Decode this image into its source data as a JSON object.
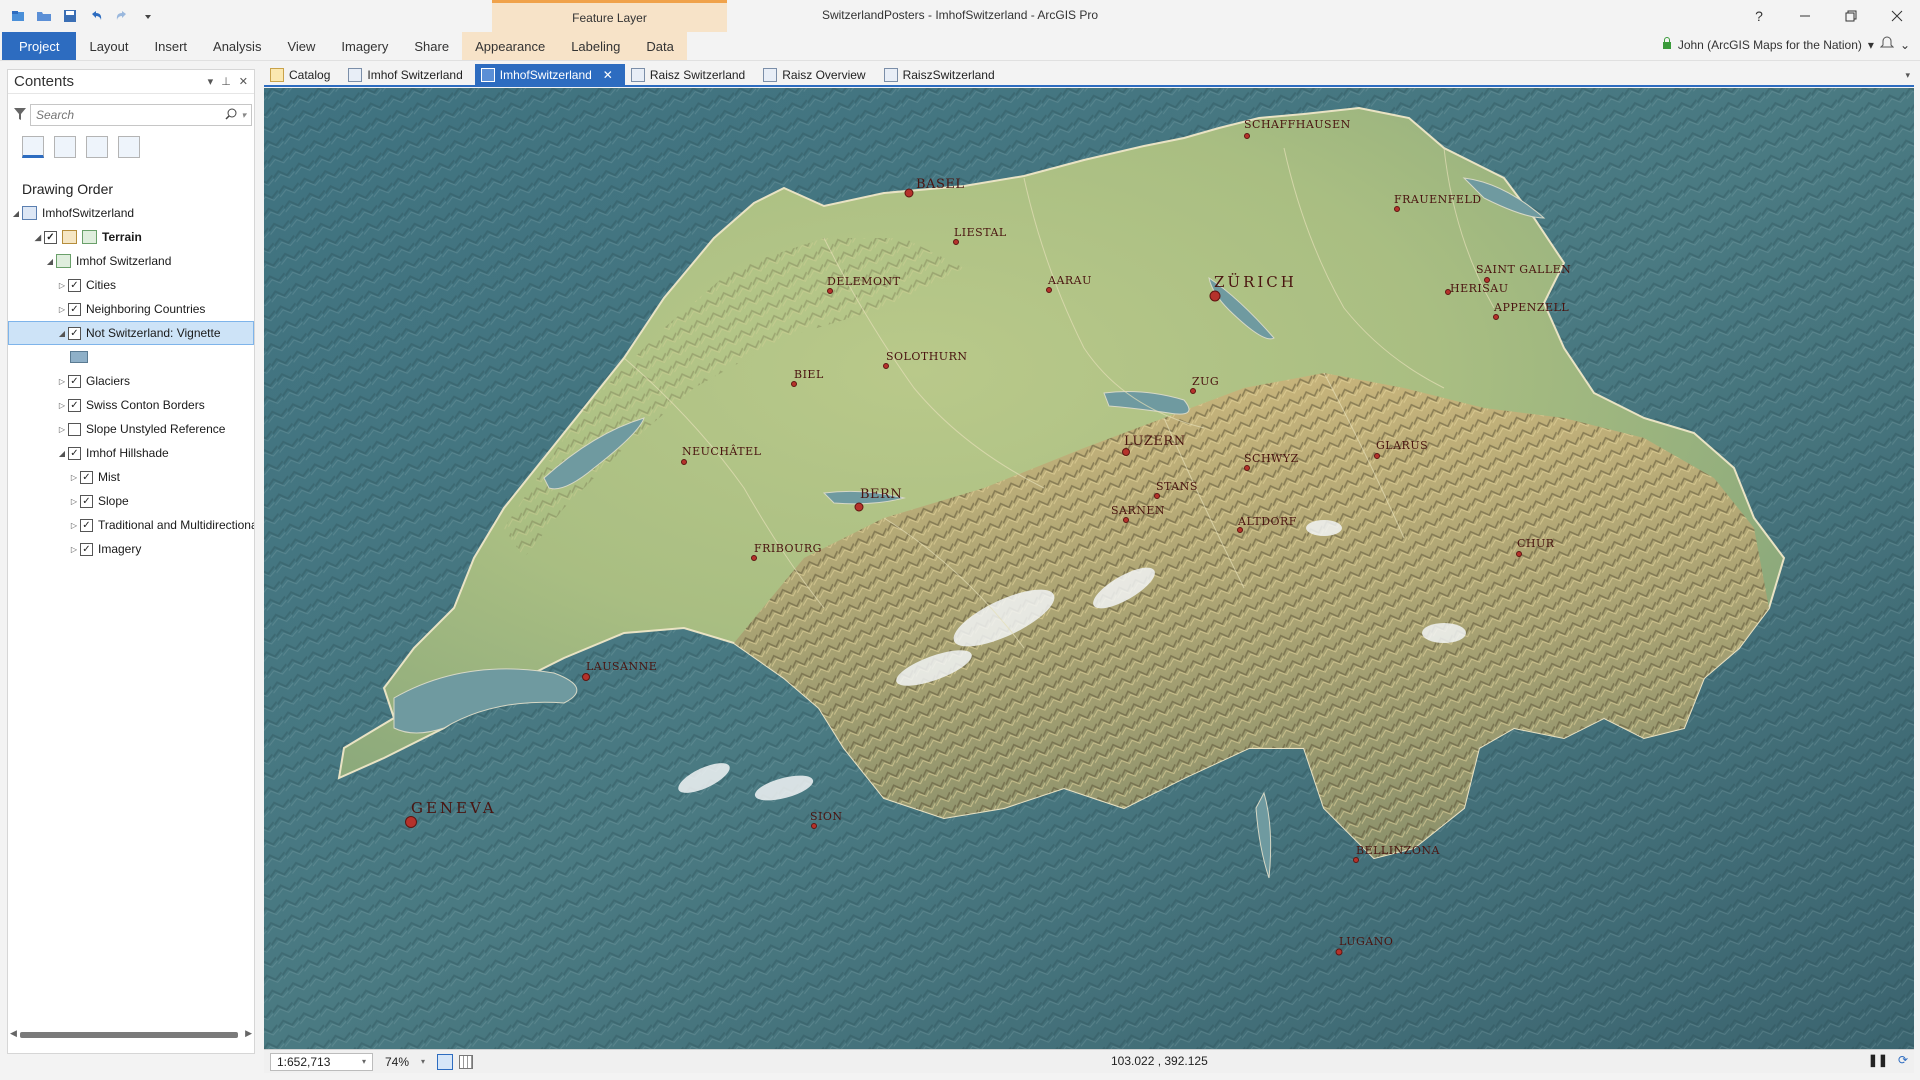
{
  "window": {
    "title": "SwitzerlandPosters - ImhofSwitzerland - ArcGIS Pro",
    "context_header": "Feature Layer",
    "help": "?"
  },
  "ribbon": {
    "tabs": [
      "Project",
      "Layout",
      "Insert",
      "Analysis",
      "View",
      "Imagery",
      "Share",
      "Appearance",
      "Labeling",
      "Data"
    ],
    "user": "John (ArcGIS Maps for the Nation)"
  },
  "contents": {
    "title": "Contents",
    "search_placeholder": "Search",
    "drawing_order": "Drawing Order",
    "tree": [
      {
        "label": "ImhofSwitzerland"
      },
      {
        "label": "Terrain"
      },
      {
        "label": "Imhof Switzerland"
      },
      {
        "label": "Cities"
      },
      {
        "label": "Neighboring Countries"
      },
      {
        "label": "Not Switzerland: Vignette"
      },
      {
        "label": "Glaciers"
      },
      {
        "label": "Swiss Conton Borders"
      },
      {
        "label": "Slope Unstyled Reference"
      },
      {
        "label": "Imhof Hillshade"
      },
      {
        "label": "Mist"
      },
      {
        "label": "Slope"
      },
      {
        "label": "Traditional and Multidirectional"
      },
      {
        "label": "Imagery"
      }
    ]
  },
  "view_tabs": [
    "Catalog",
    "Imhof Switzerland",
    "ImhofSwitzerland",
    "Raisz Switzerland",
    "Raisz Overview",
    "RaiszSwitzerland"
  ],
  "map": {
    "cities": [
      "SCHAFFHAUSEN",
      "BASEL",
      "FRAUENFELD",
      "LIESTAL",
      "ZÜRICH",
      "SAINT GALLEN",
      "HERISAU",
      "APPENZELL",
      "DELEMONT",
      "AARAU",
      "SOLOTHURN",
      "ZUG",
      "BIEL",
      "LUZERN",
      "NEUCHÂTEL",
      "SCHWYZ",
      "GLARUS",
      "BERN",
      "STANS",
      "SARNEN",
      "ALTDORF",
      "FRIBOURG",
      "CHUR",
      "LAUSANNE",
      "GENEVA",
      "SION",
      "BELLINZONA",
      "LUGANO"
    ]
  },
  "status": {
    "scale": "1:652,713",
    "zoom": "74%",
    "coords": "103.022 , 392.125"
  }
}
